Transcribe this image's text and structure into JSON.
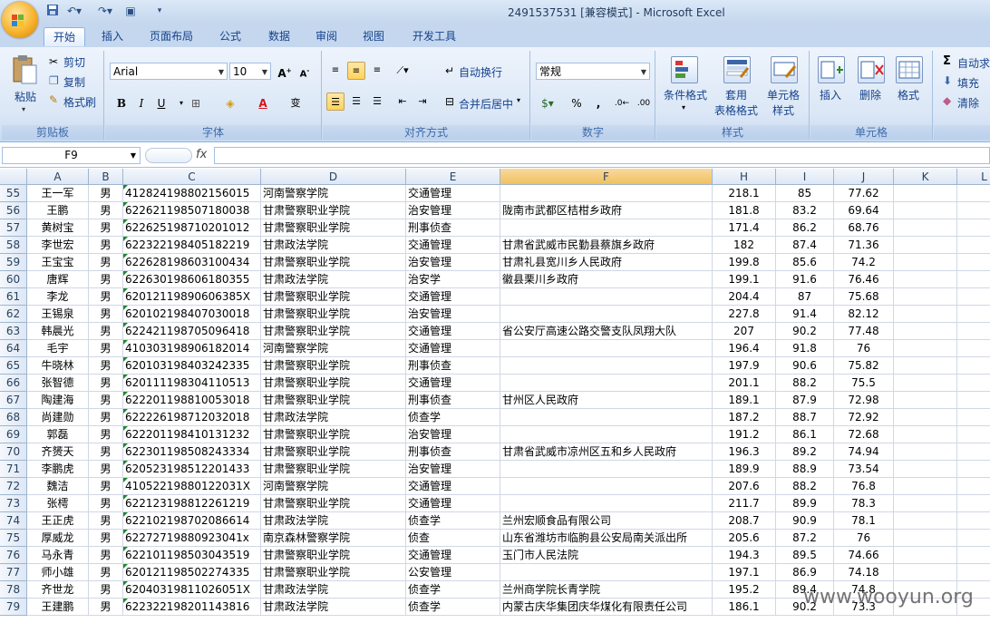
{
  "window": {
    "title": "2491537531  [兼容模式] - Microsoft Excel"
  },
  "tabs": [
    "开始",
    "插入",
    "页面布局",
    "公式",
    "数据",
    "审阅",
    "视图",
    "开发工具"
  ],
  "ribbon": {
    "clipboard": {
      "paste": "粘贴",
      "cut": "剪切",
      "copy": "复制",
      "format_painter": "格式刷",
      "label": "剪贴板"
    },
    "font": {
      "name": "Arial",
      "size": "10",
      "label": "字体"
    },
    "alignment": {
      "wrap": "自动换行",
      "merge": "合并后居中",
      "label": "对齐方式"
    },
    "number": {
      "format": "常规",
      "label": "数字"
    },
    "styles": {
      "conditional": "条件格式",
      "table_1": "套用",
      "table_2": "表格格式",
      "cell_styles_1": "单元格",
      "cell_styles_2": "样式",
      "label": "样式"
    },
    "cells": {
      "insert": "插入",
      "delete": "删除",
      "format": "格式",
      "label": "单元格"
    },
    "editing": {
      "autosum": "自动求",
      "fill": "填充",
      "clear": "清除"
    }
  },
  "formula_bar": {
    "name_box": "F9",
    "fx": "fx",
    "value": ""
  },
  "columns": [
    "A",
    "B",
    "C",
    "D",
    "E",
    "F",
    "H",
    "I",
    "J",
    "K",
    "L"
  ],
  "selected_column": "F",
  "rows": [
    {
      "n": "55",
      "a": "王一军",
      "b": "男",
      "c": "412824198802156015",
      "d": "河南警察学院",
      "e": "交通管理",
      "f": "",
      "h": "218.1",
      "i": "85",
      "j": "77.62"
    },
    {
      "n": "56",
      "a": "王鹏",
      "b": "男",
      "c": "622621198507180038",
      "d": "甘肃警察职业学院",
      "e": "治安管理",
      "f": "陇南市武都区桔柑乡政府",
      "h": "181.8",
      "i": "83.2",
      "j": "69.64"
    },
    {
      "n": "57",
      "a": "黄树宝",
      "b": "男",
      "c": "622625198710201012",
      "d": "甘肃警察职业学院",
      "e": "刑事侦查",
      "f": "",
      "h": "171.4",
      "i": "86.2",
      "j": "68.76"
    },
    {
      "n": "58",
      "a": "李世宏",
      "b": "男",
      "c": "622322198405182219",
      "d": "甘肃政法学院",
      "e": "交通管理",
      "f": "甘肃省武威市民勤县蔡旗乡政府",
      "h": "182",
      "i": "87.4",
      "j": "71.36"
    },
    {
      "n": "59",
      "a": "王宝宝",
      "b": "男",
      "c": "622628198603100434",
      "d": "甘肃警察职业学院",
      "e": "治安管理",
      "f": "甘肃礼县宽川乡人民政府",
      "h": "199.8",
      "i": "85.6",
      "j": "74.2"
    },
    {
      "n": "60",
      "a": "唐辉",
      "b": "男",
      "c": "622630198606180355",
      "d": "甘肃政法学院",
      "e": "治安学",
      "f": "徽县栗川乡政府",
      "h": "199.1",
      "i": "91.6",
      "j": "76.46"
    },
    {
      "n": "61",
      "a": "李龙",
      "b": "男",
      "c": "62012119890606385X",
      "d": "甘肃警察职业学院",
      "e": "交通管理",
      "f": "",
      "h": "204.4",
      "i": "87",
      "j": "75.68"
    },
    {
      "n": "62",
      "a": "王锡泉",
      "b": "男",
      "c": "620102198407030018",
      "d": "甘肃警察职业学院",
      "e": "治安管理",
      "f": "",
      "h": "227.8",
      "i": "91.4",
      "j": "82.12"
    },
    {
      "n": "63",
      "a": "韩晨光",
      "b": "男",
      "c": "622421198705096418",
      "d": "甘肃警察职业学院",
      "e": "交通管理",
      "f": "省公安厅高速公路交警支队凤翔大队",
      "h": "207",
      "i": "90.2",
      "j": "77.48"
    },
    {
      "n": "64",
      "a": "毛宇",
      "b": "男",
      "c": "410303198906182014",
      "d": "河南警察学院",
      "e": "交通管理",
      "f": "",
      "h": "196.4",
      "i": "91.8",
      "j": "76"
    },
    {
      "n": "65",
      "a": "牛晓林",
      "b": "男",
      "c": "620103198403242335",
      "d": "甘肃警察职业学院",
      "e": "刑事侦查",
      "f": "",
      "h": "197.9",
      "i": "90.6",
      "j": "75.82"
    },
    {
      "n": "66",
      "a": "张智德",
      "b": "男",
      "c": "620111198304110513",
      "d": "甘肃警察职业学院",
      "e": "交通管理",
      "f": "",
      "h": "201.1",
      "i": "88.2",
      "j": "75.5"
    },
    {
      "n": "67",
      "a": "陶建海",
      "b": "男",
      "c": "622201198810053018",
      "d": "甘肃警察职业学院",
      "e": "刑事侦查",
      "f": "甘州区人民政府",
      "h": "189.1",
      "i": "87.9",
      "j": "72.98"
    },
    {
      "n": "68",
      "a": "尚建勋",
      "b": "男",
      "c": "622226198712032018",
      "d": "甘肃政法学院",
      "e": "侦查学",
      "f": "",
      "h": "187.2",
      "i": "88.7",
      "j": "72.92"
    },
    {
      "n": "69",
      "a": "郭磊",
      "b": "男",
      "c": "622201198410131232",
      "d": "甘肃警察职业学院",
      "e": "治安管理",
      "f": "",
      "h": "191.2",
      "i": "86.1",
      "j": "72.68"
    },
    {
      "n": "70",
      "a": "齐赟天",
      "b": "男",
      "c": "622301198508243334",
      "d": "甘肃警察职业学院",
      "e": "刑事侦查",
      "f": "甘肃省武威市凉州区五和乡人民政府",
      "h": "196.3",
      "i": "89.2",
      "j": "74.94"
    },
    {
      "n": "71",
      "a": "李鹏虎",
      "b": "男",
      "c": "620523198512201433",
      "d": "甘肃警察职业学院",
      "e": "治安管理",
      "f": "",
      "h": "189.9",
      "i": "88.9",
      "j": "73.54"
    },
    {
      "n": "72",
      "a": "魏洁",
      "b": "男",
      "c": "41052219880122031X",
      "d": "河南警察学院",
      "e": "交通管理",
      "f": "",
      "h": "207.6",
      "i": "88.2",
      "j": "76.8"
    },
    {
      "n": "73",
      "a": "张樗",
      "b": "男",
      "c": "622123198812261219",
      "d": "甘肃警察职业学院",
      "e": "交通管理",
      "f": "",
      "h": "211.7",
      "i": "89.9",
      "j": "78.3"
    },
    {
      "n": "74",
      "a": "王正虎",
      "b": "男",
      "c": "622102198702086614",
      "d": "甘肃政法学院",
      "e": "侦查学",
      "f": "兰州宏顺食品有限公司",
      "h": "208.7",
      "i": "90.9",
      "j": "78.1"
    },
    {
      "n": "75",
      "a": "厚威龙",
      "b": "男",
      "c": "62272719880923041x",
      "d": "南京森林警察学院",
      "e": "侦查",
      "f": "山东省潍坊市临朐县公安局南关派出所",
      "h": "205.6",
      "i": "87.2",
      "j": "76"
    },
    {
      "n": "76",
      "a": "马永青",
      "b": "男",
      "c": "622101198503043519",
      "d": "甘肃警察职业学院",
      "e": "交通管理",
      "f": "玉门市人民法院",
      "h": "194.3",
      "i": "89.5",
      "j": "74.66"
    },
    {
      "n": "77",
      "a": "师小雄",
      "b": "男",
      "c": "620121198502274335",
      "d": "甘肃警察职业学院",
      "e": "公安管理",
      "f": "",
      "h": "197.1",
      "i": "86.9",
      "j": "74.18"
    },
    {
      "n": "78",
      "a": "齐世龙",
      "b": "男",
      "c": "62040319811026051X",
      "d": "甘肃政法学院",
      "e": "侦查学",
      "f": "兰州商学院长青学院",
      "h": "195.2",
      "i": "89.4",
      "j": "74.8"
    },
    {
      "n": "79",
      "a": "王建鹏",
      "b": "男",
      "c": "622322198201143816",
      "d": "甘肃政法学院",
      "e": "侦查学",
      "f": "内蒙古庆华集团庆华煤化有限责任公司",
      "h": "186.1",
      "i": "90.2",
      "j": "73.3"
    }
  ],
  "watermark": "www.wooyun.org"
}
